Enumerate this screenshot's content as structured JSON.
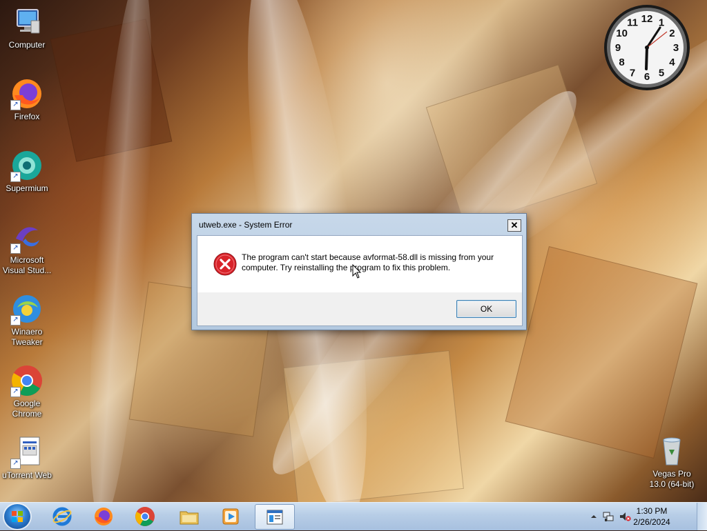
{
  "desktop": {
    "icons": [
      {
        "label": "Computer"
      },
      {
        "label": "Firefox"
      },
      {
        "label": "Supermium"
      },
      {
        "label": "Microsoft Visual Stud..."
      },
      {
        "label": "Winaero Tweaker"
      },
      {
        "label": "Google Chrome"
      },
      {
        "label": "uTorrent Web"
      },
      {
        "label": "Vegas Pro 13.0 (64-bit)"
      }
    ],
    "clock_numbers": [
      "12",
      "1",
      "2",
      "3",
      "4",
      "5",
      "6",
      "7",
      "8",
      "9",
      "10",
      "11"
    ]
  },
  "dialog": {
    "title": "utweb.exe - System Error",
    "close_label": "✕",
    "message": "The program can't start because avformat-58.dll is missing from your computer. Try reinstalling the program to fix this problem.",
    "ok_label": "OK",
    "icon": "error-icon"
  },
  "taskbar": {
    "start_icon": "windows-logo-icon",
    "pinned": [
      {
        "name": "internet-explorer-icon"
      },
      {
        "name": "firefox-icon"
      },
      {
        "name": "chrome-icon"
      },
      {
        "name": "file-explorer-icon"
      },
      {
        "name": "media-player-icon"
      },
      {
        "name": "utweb-window-icon",
        "active": true
      }
    ],
    "tray": {
      "time": "1:30 PM",
      "date": "2/26/2024",
      "icons": [
        "show-hidden-icons-icon",
        "network-icon",
        "volume-muted-icon"
      ]
    }
  },
  "colors": {
    "taskbar": "#b7cde6",
    "dialog_frame": "#c7d8ea",
    "error_red": "#d8232a",
    "ok_border": "#3c7fb1"
  }
}
